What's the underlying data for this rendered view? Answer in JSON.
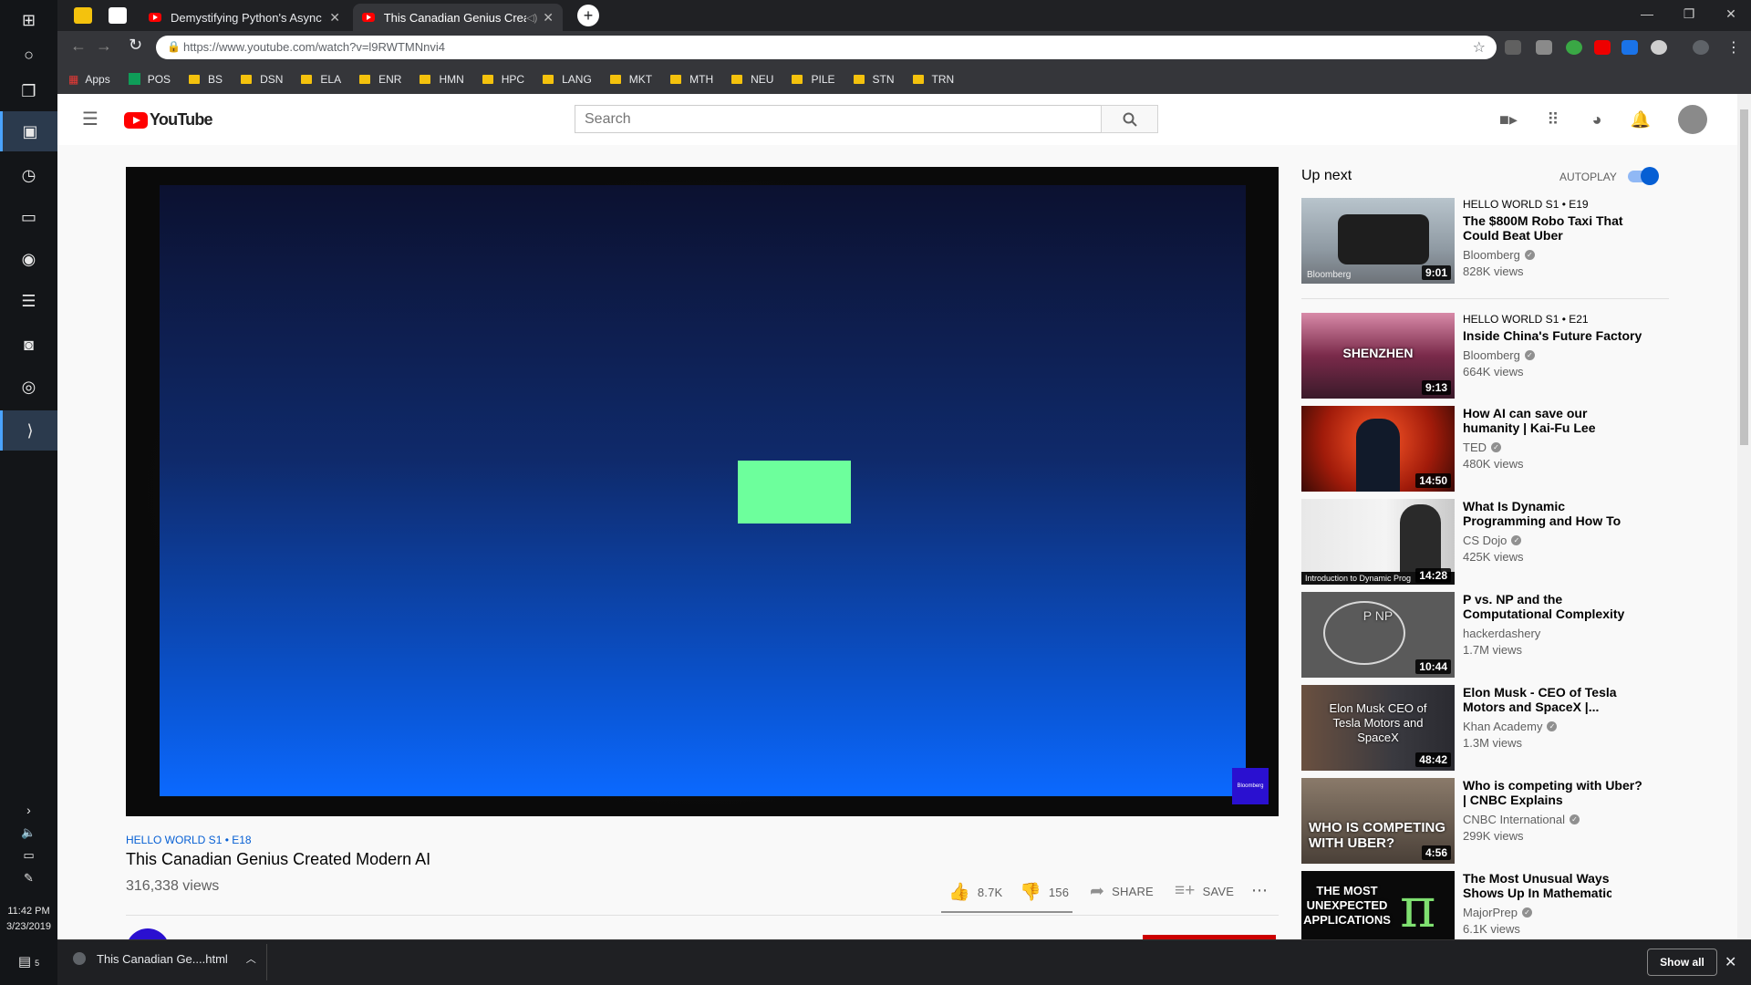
{
  "taskbar": {
    "clock_time": "11:42 PM",
    "clock_date": "3/23/2019",
    "notification_count": "5"
  },
  "browser": {
    "tabs": [
      {
        "label": "Demystifying Python's Async and"
      },
      {
        "label": "This Canadian Genius Create"
      }
    ],
    "url": "https://www.youtube.com/watch?v=l9RWTMNnvi4",
    "bookmarks": [
      "Apps",
      "POS",
      "BS",
      "DSN",
      "ELA",
      "ENR",
      "HMN",
      "HPC",
      "LANG",
      "MKT",
      "MTH",
      "NEU",
      "PILE",
      "STN",
      "TRN"
    ]
  },
  "youtube": {
    "logo_text": "YouTube",
    "search_placeholder": "Search",
    "video": {
      "series_tag": "HELLO WORLD  S1 • E18",
      "title": "This Canadian Genius Created Modern AI",
      "views": "316,338 views",
      "likes": "8.7K",
      "dislikes": "156",
      "share_label": "SHARE",
      "save_label": "SAVE",
      "watermark": "Bloomberg"
    },
    "sidebar": {
      "up_next": "Up next",
      "autoplay": "AUTOPLAY",
      "autoplay_on": true,
      "items": [
        {
          "sub": "HELLO WORLD  S1 • E19",
          "title": "The $800M Robo Taxi That Could Beat Uber",
          "channel": "Bloomberg",
          "views": "828K views",
          "duration": "9:01",
          "thumb_text": "Bloomberg"
        },
        {
          "sub": "HELLO WORLD  S1 • E21",
          "title": "Inside China's Future Factory",
          "channel": "Bloomberg",
          "views": "664K views",
          "duration": "9:13",
          "thumb_text": "SHENZHEN"
        },
        {
          "sub": "",
          "title": "How AI can save our humanity | Kai-Fu Lee",
          "channel": "TED",
          "views": "480K views",
          "duration": "14:50",
          "thumb_text": ""
        },
        {
          "sub": "",
          "title": "What Is Dynamic Programming and How To Use It",
          "channel": "CS Dojo",
          "views": "425K views",
          "duration": "14:28",
          "thumb_text": "Introduction to Dynamic Prog"
        },
        {
          "sub": "",
          "title": "P vs. NP and the Computational Complexity Zoo",
          "channel": "hackerdashery",
          "views": "1.7M views",
          "duration": "10:44",
          "thumb_text": "P   NP"
        },
        {
          "sub": "",
          "title": "Elon Musk - CEO of Tesla Motors and SpaceX |...",
          "channel": "Khan Academy",
          "views": "1.3M views",
          "duration": "48:42",
          "thumb_text": "Elon Musk CEO of Tesla Motors and SpaceX"
        },
        {
          "sub": "",
          "title": "Who is competing with Uber? | CNBC Explains",
          "channel": "CNBC International",
          "views": "299K views",
          "duration": "4:56",
          "thumb_text": "WHO IS COMPETING WITH UBER?"
        },
        {
          "sub": "",
          "title": "The Most Unusual Ways Pi Shows Up In Mathematics | Ca...",
          "channel": "MajorPrep",
          "views": "6.1K views",
          "duration": "",
          "thumb_text": "THE MOST UNEXPECTED APPLICATIONS"
        }
      ]
    }
  },
  "downloads": {
    "file": "This Canadian Ge....html",
    "show_all": "Show all"
  }
}
